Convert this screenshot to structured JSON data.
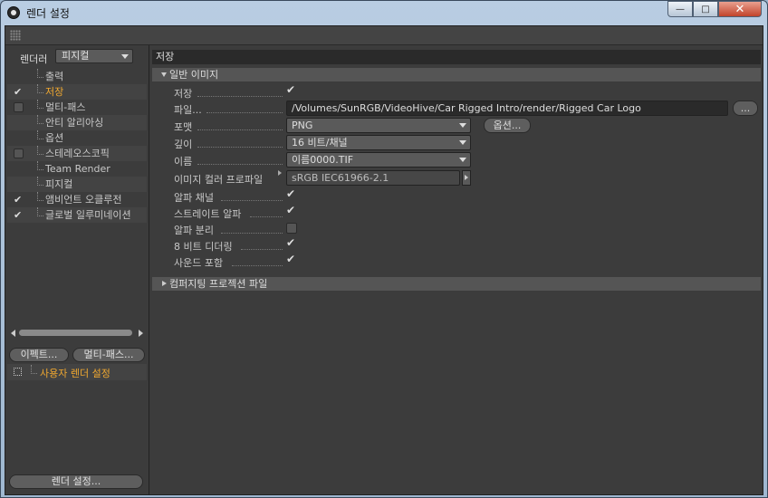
{
  "window": {
    "title": "렌더 설정"
  },
  "window_buttons": {
    "minimize": "—",
    "maximize": "□",
    "close": "✕"
  },
  "renderer": {
    "label": "렌더러",
    "selected": "피지컬"
  },
  "tree": [
    {
      "label": "출력",
      "checkbox": "none",
      "active": false
    },
    {
      "label": "저장",
      "checkbox": "checked",
      "active": true
    },
    {
      "label": "멀티-패스",
      "checkbox": "empty",
      "active": false
    },
    {
      "label": "안티 알리아싱",
      "checkbox": "none",
      "active": false
    },
    {
      "label": "옵션",
      "checkbox": "none",
      "active": false
    },
    {
      "label": "스테레오스코픽",
      "checkbox": "empty",
      "active": false
    },
    {
      "label": "Team Render",
      "checkbox": "none",
      "active": false
    },
    {
      "label": "피지컬",
      "checkbox": "none",
      "active": false
    },
    {
      "label": "앰비언트 오클루전",
      "checkbox": "checked",
      "active": false
    },
    {
      "label": "글로벌 일루미네이션",
      "checkbox": "checked",
      "active": false
    }
  ],
  "buttons": {
    "effect": "이펙트...",
    "multipass": "멀티-패스...",
    "render_settings": "렌더 설정..."
  },
  "user_settings": {
    "label": "사용자 렌더 설정"
  },
  "panel": {
    "title": "저장",
    "general_section": "일반 이미지",
    "composite_section": "컴퍼지팅 프로젝션 파일",
    "save_label": "저장",
    "file_label": "파일...",
    "file_value": "/Volumes/SunRGB/VideoHive/Car Rigged Intro/render/Rigged Car Logo",
    "file_button": "...",
    "format_label": "포맷",
    "format_value": "PNG",
    "options_button": "옵션...",
    "depth_label": "깊이",
    "depth_value": "16 비트/채널",
    "name_label": "이름",
    "name_value": "이름0000.TIF",
    "color_profile_label": "이미지 컬러 프로파일",
    "color_profile_value": "sRGB IEC61966-2.1",
    "alpha_label": "알파 채널",
    "straight_alpha_label": "스트레이트 알파",
    "separate_alpha_label": "알파 분리",
    "dither_label": "8 비트 디더링",
    "sound_label": "사운드 포함"
  }
}
